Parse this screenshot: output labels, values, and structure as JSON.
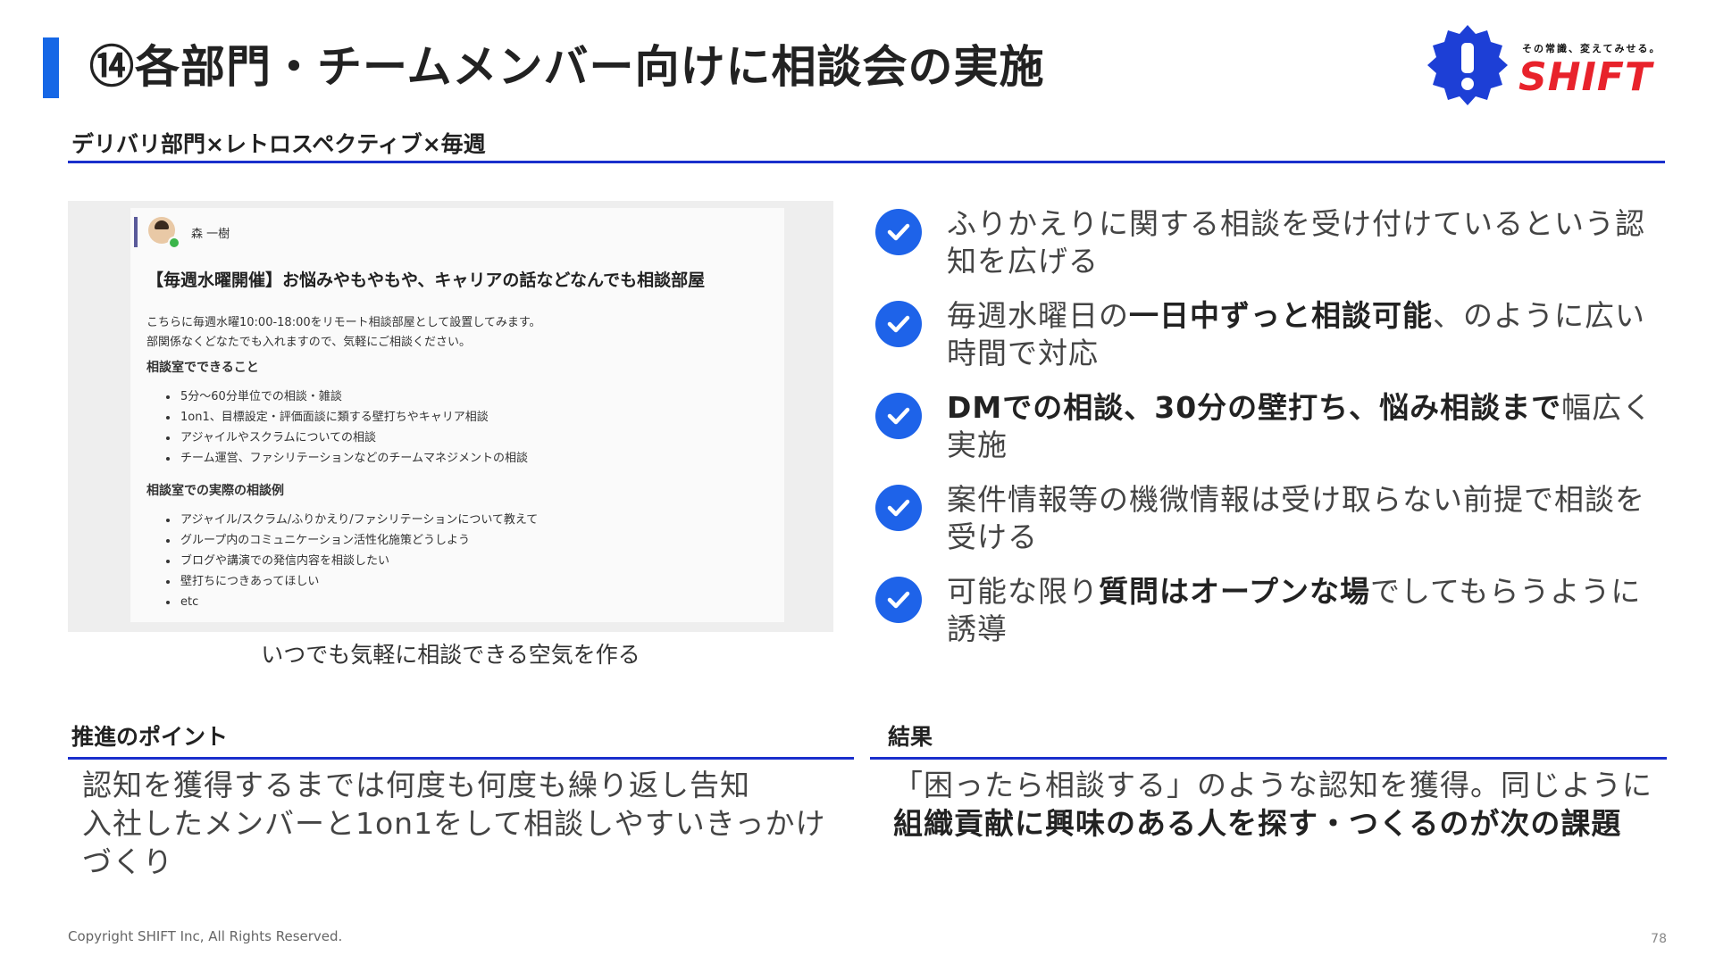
{
  "title": "⑭各部門・チームメンバー向けに相談会の実施",
  "logo": {
    "tagline": "その常識、変えてみせる。",
    "word": "SHIFT",
    "brand_blue": "#1d3fd6",
    "brand_red": "#e8222b"
  },
  "subtitle": "デリバリ部門×レトロスペクティブ×毎週",
  "screenshot": {
    "author": "森 一樹",
    "heading": "【毎週水曜開催】お悩みやもやもや、キャリアの話などなんでも相談部屋",
    "intro_line1": "こちらに毎週水曜10:00-18:00をリモート相談部屋として設置してみます。",
    "intro_line2": "部関係なくどなたでも入れますので、気軽にご相談ください。",
    "section1_title": "相談室でできること",
    "section1_items": [
      "5分～60分単位での相談・雑談",
      "1on1、目標設定・評価面談に類する壁打ちやキャリア相談",
      "アジャイルやスクラムについての相談",
      "チーム運営、ファシリテーションなどのチームマネジメントの相談"
    ],
    "section2_title": "相談室での実際の相談例",
    "section2_items": [
      "アジャイル/スクラム/ふりかえり/ファシリテーションについて教えて",
      "グループ内のコミュニケーション活性化施策どうしよう",
      "ブログや講演での発信内容を相談したい",
      "壁打ちにつきあってほしい",
      "etc"
    ]
  },
  "caption": "いつでも気軽に相談できる空気を作る",
  "checks": [
    {
      "pre": "ふりかえりに関する相談を受け付けているという認知を広げる",
      "bold": "",
      "post": ""
    },
    {
      "pre": "毎週水曜日の",
      "bold": "一日中ずっと相談可能",
      "post": "、のように広い時間で対応"
    },
    {
      "pre": "",
      "bold": "DMでの相談、30分の壁打ち、悩み相談まで",
      "post": "幅広く実施"
    },
    {
      "pre": "案件情報等の機微情報は受け取らない前提で相談を受ける",
      "bold": "",
      "post": ""
    },
    {
      "pre": "可能な限り",
      "bold": "質問はオープンな場",
      "post": "でしてもらうように誘導"
    }
  ],
  "points": {
    "label": "推進のポイント",
    "line1": "認知を獲得するまでは何度も何度も繰り返し告知",
    "line2": "入社したメンバーと1on1をして相談しやすいきっかけづくり"
  },
  "result": {
    "label": "結果",
    "pre": "「困ったら相談する」のような認知を獲得。同じように",
    "bold": "組織貢献に興味のある人を探す・つくるのが次の課題"
  },
  "footer": "Copyright SHIFT Inc, All Rights Reserved.",
  "page_number": "78",
  "accent_color": "#1e63e9",
  "rule_color": "#1a2fcc"
}
